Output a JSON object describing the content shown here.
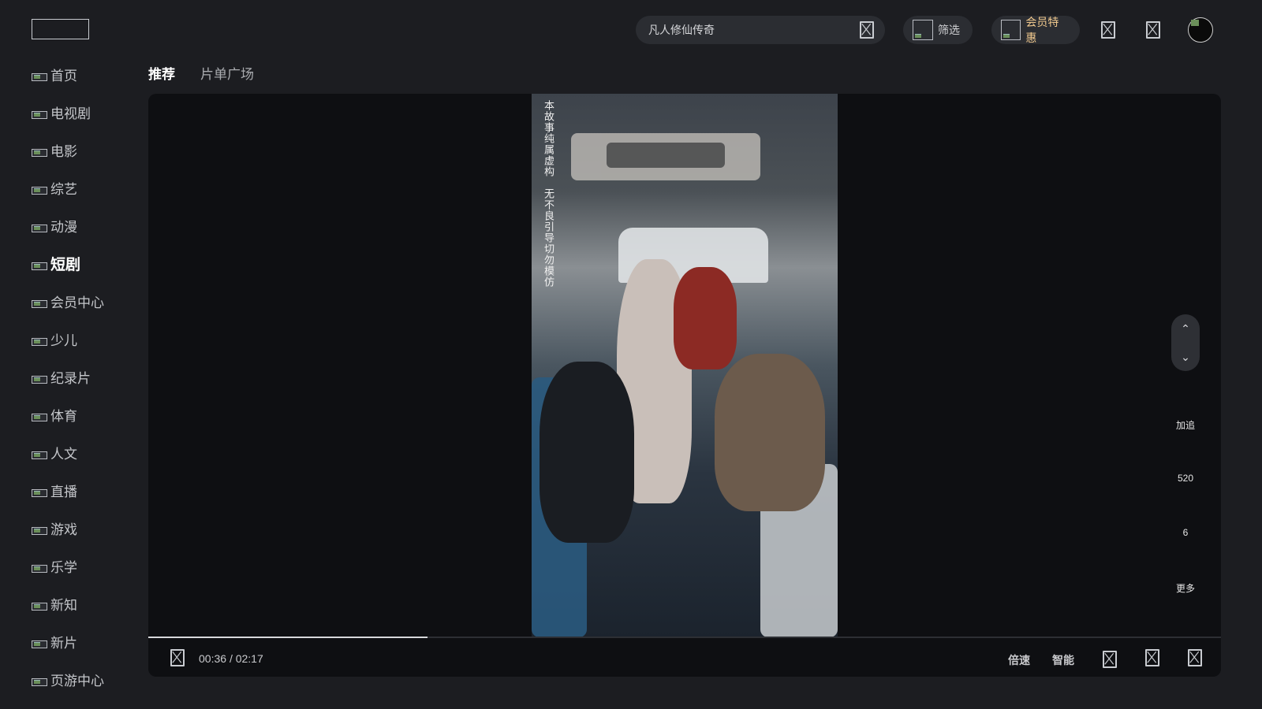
{
  "search": {
    "value": "凡人修仙传奇"
  },
  "header": {
    "filter_label": "筛选",
    "vip_label": "会员特惠"
  },
  "sidebar": {
    "items": [
      {
        "label": "首页"
      },
      {
        "label": "电视剧"
      },
      {
        "label": "电影"
      },
      {
        "label": "综艺"
      },
      {
        "label": "动漫"
      },
      {
        "label": "短剧",
        "active": true
      },
      {
        "label": "会员中心"
      },
      {
        "label": "少儿"
      },
      {
        "label": "纪录片"
      },
      {
        "label": "体育"
      },
      {
        "label": "人文"
      },
      {
        "label": "直播"
      },
      {
        "label": "游戏"
      },
      {
        "label": "乐学"
      },
      {
        "label": "新知"
      },
      {
        "label": "新片"
      },
      {
        "label": "页游中心"
      }
    ]
  },
  "tabs": [
    {
      "label": "推荐",
      "active": true
    },
    {
      "label": "片单广场"
    }
  ],
  "video": {
    "caption": "本故事纯属虚构　无不良引导切勿模仿",
    "side_actions": {
      "follow": "加追",
      "likes": "520",
      "comments": "6",
      "more": "更多"
    },
    "current_time": "00:36",
    "time_separator": "/",
    "duration": "02:17",
    "progress": 0.26,
    "speed_label": "倍速",
    "quality_label": "智能"
  },
  "colors": {
    "vip_gold": "#f1c98e",
    "background": "#1c1d21",
    "player_bg": "#0e0f12"
  }
}
